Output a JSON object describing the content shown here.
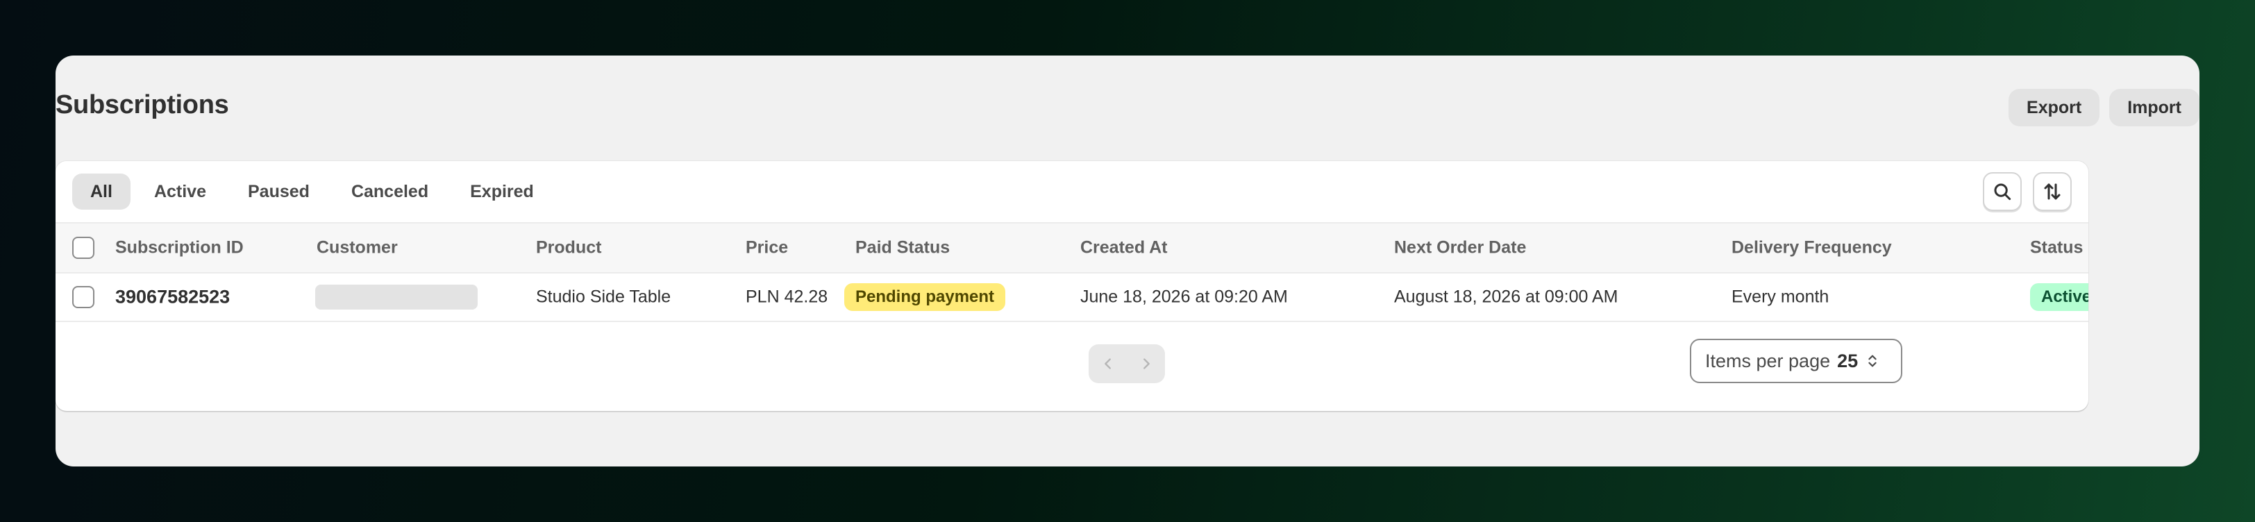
{
  "page": {
    "title": "Subscriptions",
    "actions": {
      "export_label": "Export",
      "import_label": "Import"
    }
  },
  "tabs": [
    {
      "label": "All",
      "selected": true
    },
    {
      "label": "Active",
      "selected": false
    },
    {
      "label": "Paused",
      "selected": false
    },
    {
      "label": "Canceled",
      "selected": false
    },
    {
      "label": "Expired",
      "selected": false
    }
  ],
  "toolbar_icons": [
    "search-icon",
    "sort-icon"
  ],
  "table": {
    "columns": [
      "Subscription ID",
      "Customer",
      "Product",
      "Price",
      "Paid Status",
      "Created At",
      "Next Order Date",
      "Delivery Frequency",
      "Status"
    ],
    "rows": [
      {
        "subscription_id": "39067582523",
        "customer": "",
        "product": "Studio Side Table",
        "price": "PLN 42.28",
        "paid_status": "Pending payment",
        "created_at": "June 18, 2026 at 09:20 AM",
        "next_order_date": "August 18, 2026 at 09:00 AM",
        "delivery_frequency": "Every month",
        "status": "Active"
      }
    ]
  },
  "pagination": {
    "items_per_page_label": "Items per page",
    "items_per_page_value": "25"
  },
  "colors": {
    "pending_badge_bg": "#ffeb78",
    "active_badge_bg": "#b4fed2",
    "card_bg": "#f1f1f1"
  }
}
